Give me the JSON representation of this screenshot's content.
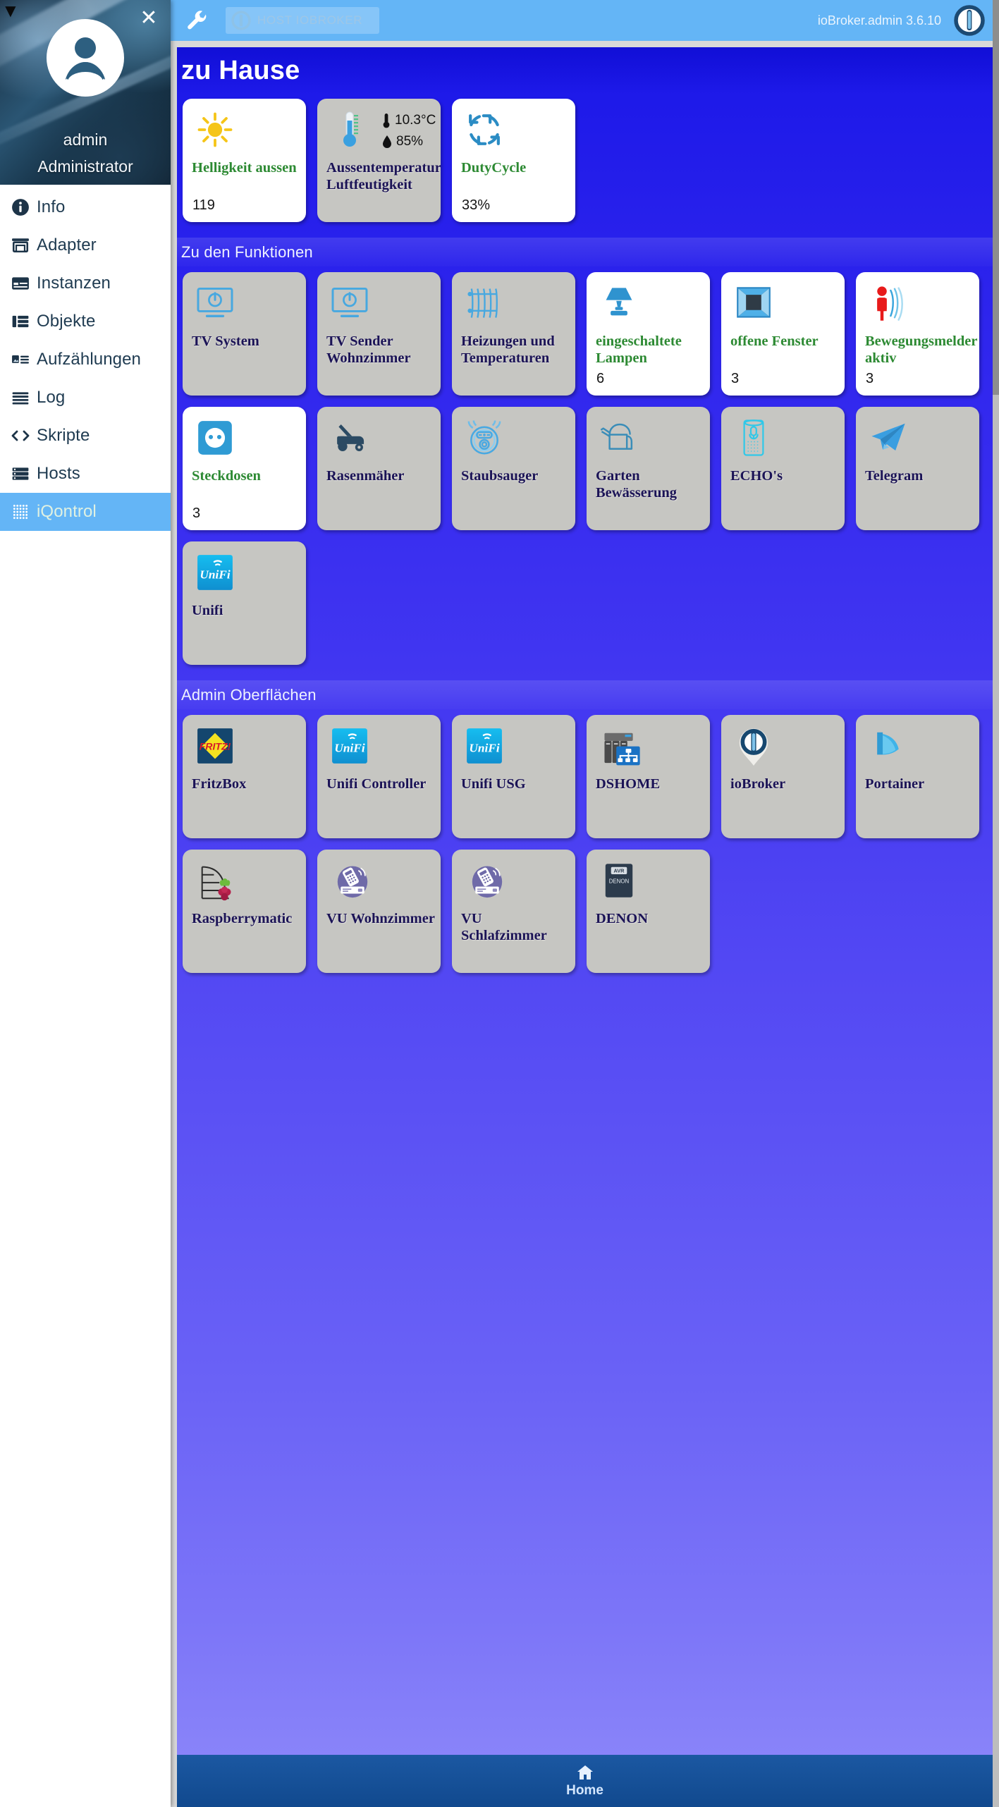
{
  "sidebar": {
    "user": {
      "name": "admin",
      "role": "Administrator"
    },
    "close_icon": "close-icon",
    "items": [
      {
        "label": "Info",
        "icon": "info-circle-icon",
        "active": false
      },
      {
        "label": "Adapter",
        "icon": "store-icon",
        "active": false
      },
      {
        "label": "Instanzen",
        "icon": "card-list-icon",
        "active": false
      },
      {
        "label": "Objekte",
        "icon": "table-rows-icon",
        "active": false
      },
      {
        "label": "Aufzählungen",
        "icon": "image-list-icon",
        "active": false
      },
      {
        "label": "Log",
        "icon": "lines-icon",
        "active": false
      },
      {
        "label": "Skripte",
        "icon": "code-brackets-icon",
        "active": false
      },
      {
        "label": "Hosts",
        "icon": "server-icon",
        "active": false
      },
      {
        "label": "iQontrol",
        "icon": "dots-grid-icon",
        "active": true
      }
    ]
  },
  "appbar": {
    "wrench_icon": "wrench-icon",
    "host_chip": {
      "icon": "iobroker-logo-icon",
      "label": "HOST IOBROKER"
    },
    "version": "ioBroker.admin 3.6.10",
    "logo_icon": "iobroker-logo-icon"
  },
  "page": {
    "title": "zu Hause",
    "sections": [
      {
        "heading": "",
        "tiles": [
          {
            "name": "Helligkeit aussen",
            "value": "119",
            "icon": "sun-icon",
            "style": "white",
            "name_color": "green"
          },
          {
            "name": "Aussentemperatur Luftfeutigkeit",
            "icon": "thermometer-icon",
            "style": "grey",
            "name_color": "dark",
            "readings": [
              {
                "icon": "thermometer-small-icon",
                "text": "10.3°C"
              },
              {
                "icon": "droplet-icon",
                "text": "85%"
              }
            ]
          },
          {
            "name": "DutyCycle",
            "value": "33%",
            "icon": "refresh-cycle-icon",
            "style": "white",
            "name_color": "green"
          }
        ]
      },
      {
        "heading": "Zu den Funktionen",
        "tiles": [
          {
            "name": "TV System",
            "icon": "tv-power-icon",
            "style": "grey",
            "name_color": "dark"
          },
          {
            "name": "TV Sender Wohnzimmer",
            "icon": "tv-power-icon",
            "style": "grey",
            "name_color": "dark"
          },
          {
            "name": "Heizungen und Temperaturen",
            "icon": "radiator-icon",
            "style": "grey",
            "name_color": "dark"
          },
          {
            "name": "eingeschaltete Lampen",
            "value": "6",
            "icon": "lamp-icon",
            "style": "white",
            "name_color": "green"
          },
          {
            "name": "offene Fenster",
            "value": "3",
            "icon": "window-open-icon",
            "style": "white",
            "name_color": "green"
          },
          {
            "name": "Bewegungsmelder aktiv",
            "value": "3",
            "icon": "motion-sensor-icon",
            "style": "white",
            "name_color": "green"
          },
          {
            "name": "Steckdosen",
            "value": "3",
            "icon": "power-socket-icon",
            "style": "white",
            "name_color": "green"
          },
          {
            "name": "Rasenmäher",
            "icon": "lawnmower-icon",
            "style": "grey",
            "name_color": "dark"
          },
          {
            "name": "Staubsauger",
            "icon": "robot-vacuum-icon",
            "style": "grey",
            "name_color": "dark"
          },
          {
            "name": "Garten Bewässerung",
            "icon": "watering-can-icon",
            "style": "grey",
            "name_color": "dark"
          },
          {
            "name": "ECHO's",
            "icon": "echo-speaker-icon",
            "style": "grey",
            "name_color": "dark"
          },
          {
            "name": "Telegram",
            "icon": "telegram-icon",
            "style": "grey",
            "name_color": "dark"
          },
          {
            "name": "Unifi",
            "icon": "unifi-logo-icon",
            "style": "grey",
            "name_color": "dark"
          }
        ]
      },
      {
        "heading": "Admin Oberflächen",
        "tiles": [
          {
            "name": "FritzBox",
            "icon": "fritzbox-logo-icon",
            "style": "grey",
            "name_color": "dark"
          },
          {
            "name": "Unifi Controller",
            "icon": "unifi-logo-icon",
            "style": "grey",
            "name_color": "dark"
          },
          {
            "name": "Unifi USG",
            "icon": "unifi-logo-icon",
            "style": "grey",
            "name_color": "dark"
          },
          {
            "name": "DSHOME",
            "icon": "nas-network-icon",
            "style": "grey",
            "name_color": "dark"
          },
          {
            "name": "ioBroker",
            "icon": "iobroker-pin-icon",
            "style": "grey",
            "name_color": "dark"
          },
          {
            "name": "Portainer",
            "icon": "portainer-whale-icon",
            "style": "grey",
            "name_color": "dark"
          },
          {
            "name": "Raspberrymatic",
            "icon": "raspberrymatic-icon",
            "style": "grey",
            "name_color": "dark"
          },
          {
            "name": "VU Wohnzimmer",
            "icon": "vu-remote-icon",
            "style": "grey",
            "name_color": "dark"
          },
          {
            "name": "VU Schlafzimmer",
            "icon": "vu-remote-icon",
            "style": "grey",
            "name_color": "dark"
          },
          {
            "name": "DENON",
            "icon": "denon-avr-icon",
            "style": "grey",
            "name_color": "dark"
          }
        ]
      }
    ]
  },
  "bottomnav": {
    "label": "Home",
    "icon": "home-icon"
  },
  "colors": {
    "appbar": "#64b5f6",
    "accent_green": "#2d8a33",
    "tile_dark_text": "#1b1356",
    "bottom_nav": "#14529b"
  }
}
